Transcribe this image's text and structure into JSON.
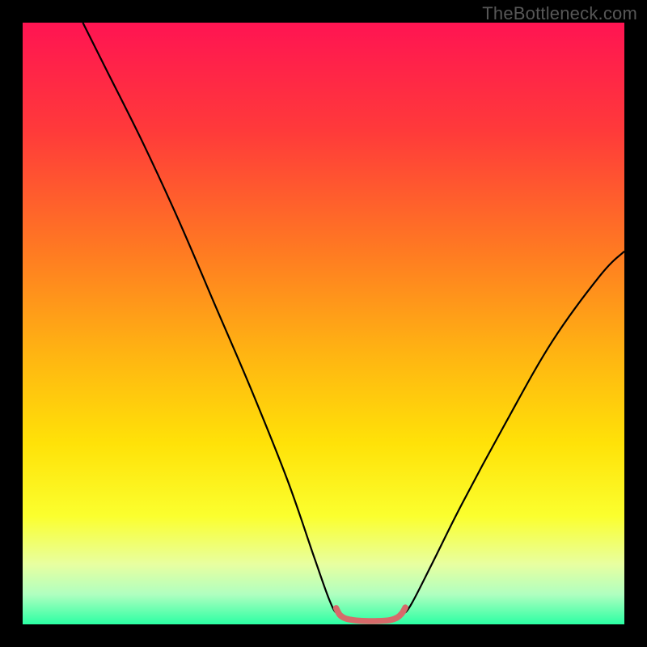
{
  "watermark": "TheBottleneck.com",
  "gradient_stops": [
    {
      "offset": 0.0,
      "color": "#ff1452"
    },
    {
      "offset": 0.18,
      "color": "#ff3a3a"
    },
    {
      "offset": 0.38,
      "color": "#ff7a22"
    },
    {
      "offset": 0.55,
      "color": "#ffb412"
    },
    {
      "offset": 0.7,
      "color": "#ffe208"
    },
    {
      "offset": 0.82,
      "color": "#fbff2e"
    },
    {
      "offset": 0.9,
      "color": "#e8ffa0"
    },
    {
      "offset": 0.95,
      "color": "#b0ffc0"
    },
    {
      "offset": 1.0,
      "color": "#2bffa3"
    }
  ],
  "chart_data": {
    "type": "line",
    "title": "",
    "xlabel": "",
    "ylabel": "",
    "xlim": [
      0,
      100
    ],
    "ylim": [
      0,
      100
    ],
    "series": [
      {
        "name": "bottleneck-curve",
        "stroke": "#000000",
        "stroke_width": 2.2,
        "points": [
          {
            "x": 10.0,
            "y": 100.0
          },
          {
            "x": 14.0,
            "y": 92.0
          },
          {
            "x": 20.0,
            "y": 80.0
          },
          {
            "x": 26.0,
            "y": 67.0
          },
          {
            "x": 32.0,
            "y": 53.0
          },
          {
            "x": 38.0,
            "y": 39.0
          },
          {
            "x": 44.0,
            "y": 24.0
          },
          {
            "x": 48.5,
            "y": 11.0
          },
          {
            "x": 51.0,
            "y": 4.0
          },
          {
            "x": 52.3,
            "y": 1.7
          },
          {
            "x": 54.0,
            "y": 0.9
          },
          {
            "x": 56.0,
            "y": 0.6
          },
          {
            "x": 58.0,
            "y": 0.6
          },
          {
            "x": 60.0,
            "y": 0.6
          },
          {
            "x": 61.5,
            "y": 0.8
          },
          {
            "x": 63.0,
            "y": 1.6
          },
          {
            "x": 64.5,
            "y": 3.2
          },
          {
            "x": 68.0,
            "y": 10.0
          },
          {
            "x": 73.0,
            "y": 20.0
          },
          {
            "x": 80.0,
            "y": 33.0
          },
          {
            "x": 88.0,
            "y": 47.0
          },
          {
            "x": 96.0,
            "y": 58.0
          },
          {
            "x": 100.0,
            "y": 62.0
          }
        ]
      },
      {
        "name": "optimal-band",
        "stroke": "#d66a6a",
        "stroke_width": 7.5,
        "linecap": "round",
        "points": [
          {
            "x": 52.1,
            "y": 2.7
          },
          {
            "x": 52.7,
            "y": 1.6
          },
          {
            "x": 53.6,
            "y": 1.0
          },
          {
            "x": 55.0,
            "y": 0.7
          },
          {
            "x": 57.0,
            "y": 0.55
          },
          {
            "x": 59.0,
            "y": 0.55
          },
          {
            "x": 61.0,
            "y": 0.7
          },
          {
            "x": 62.2,
            "y": 1.1
          },
          {
            "x": 63.0,
            "y": 1.8
          },
          {
            "x": 63.6,
            "y": 2.8
          }
        ]
      }
    ]
  }
}
